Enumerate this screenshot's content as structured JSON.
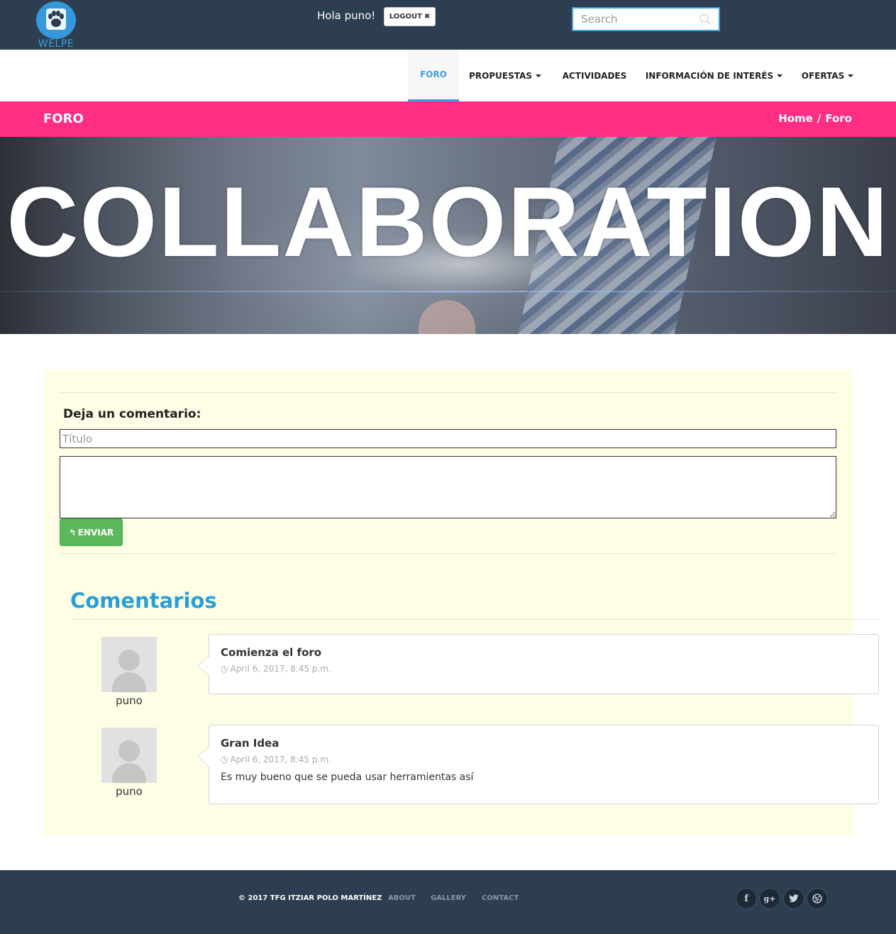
{
  "header": {
    "logo_text": "WELPE",
    "greeting": "Hola puno!",
    "logout_label": "LOGOUT",
    "search_placeholder": "Search"
  },
  "nav": {
    "items": [
      {
        "label": "FORO",
        "active": true,
        "dropdown": false
      },
      {
        "label": "PROPUESTAS",
        "active": false,
        "dropdown": true
      },
      {
        "label": "ACTIVIDADES",
        "active": false,
        "dropdown": false
      },
      {
        "label": "INFORMACIÓN DE INTERÉS",
        "active": false,
        "dropdown": true
      },
      {
        "label": "OFERTAS",
        "active": false,
        "dropdown": true
      }
    ]
  },
  "titlebar": {
    "title": "FORO",
    "breadcrumb": [
      "Home",
      "/",
      "Foro"
    ]
  },
  "hero": {
    "text": "COLLABORATION"
  },
  "form": {
    "heading": "Deja un comentario:",
    "title_placeholder": "Título",
    "send_label": "ENVIAR"
  },
  "comments": {
    "heading": "Comentarios",
    "items": [
      {
        "author": "puno",
        "title": "Comienza el foro",
        "date": "April 6, 2017, 8:45 p.m.",
        "body": ""
      },
      {
        "author": "puno",
        "title": "Gran Idea",
        "date": "April 6, 2017, 8:45 p.m.",
        "body": "Es muy bueno que se pueda usar herramientas así"
      }
    ]
  },
  "footer": {
    "copyright": "© 2017 TFG ITZIAR POLO MARTÍNEZ",
    "links": [
      "ABOUT",
      "GALLERY",
      "CONTACT"
    ],
    "social": [
      "facebook-icon",
      "google-plus-icon",
      "twitter-icon",
      "dribbble-icon"
    ]
  },
  "colors": {
    "topbar": "#2c3e50",
    "accent_blue": "#2a9fd6",
    "pink": "#ff2d84",
    "panel": "#fefee6",
    "send_green": "#5cb85c"
  }
}
